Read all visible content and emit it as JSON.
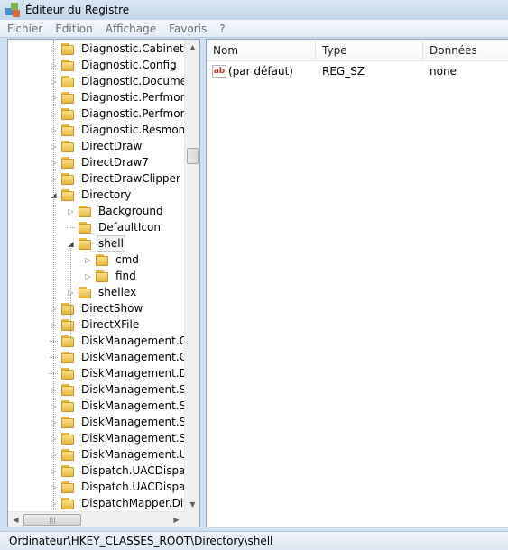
{
  "window": {
    "title": "Éditeur du Registre"
  },
  "menu": [
    "Fichier",
    "Edition",
    "Affichage",
    "Favoris",
    "?"
  ],
  "tree": {
    "items": [
      {
        "label": "Diagnostic.Cabinet",
        "expander": "collapsed"
      },
      {
        "label": "Diagnostic.Config",
        "expander": "collapsed"
      },
      {
        "label": "Diagnostic.Document",
        "expander": "collapsed"
      },
      {
        "label": "Diagnostic.Perfmon.C",
        "expander": "collapsed"
      },
      {
        "label": "Diagnostic.Perfmon.D",
        "expander": "collapsed"
      },
      {
        "label": "Diagnostic.Resmon.C",
        "expander": "collapsed"
      },
      {
        "label": "DirectDraw",
        "expander": "collapsed"
      },
      {
        "label": "DirectDraw7",
        "expander": "collapsed"
      },
      {
        "label": "DirectDrawClipper",
        "expander": "collapsed"
      },
      {
        "label": "Directory",
        "expander": "expanded"
      },
      {
        "label": "Background",
        "expander": "collapsed"
      },
      {
        "label": "DefaultIcon",
        "expander": "none"
      },
      {
        "label": "shell",
        "expander": "expanded",
        "selected": true
      },
      {
        "label": "cmd",
        "expander": "collapsed"
      },
      {
        "label": "find",
        "expander": "collapsed"
      },
      {
        "label": "shellex",
        "expander": "collapsed"
      },
      {
        "label": "DirectShow",
        "expander": "collapsed"
      },
      {
        "label": "DirectXFile",
        "expander": "collapsed"
      },
      {
        "label": "DiskManagement.Cor",
        "expander": "none"
      },
      {
        "label": "DiskManagement.Cor",
        "expander": "none"
      },
      {
        "label": "DiskManagement.Dat",
        "expander": "none"
      },
      {
        "label": "DiskManagement.Sna",
        "expander": "collapsed"
      },
      {
        "label": "DiskManagement.Sna",
        "expander": "collapsed"
      },
      {
        "label": "DiskManagement.Sna",
        "expander": "collapsed"
      },
      {
        "label": "DiskManagement.Sna",
        "expander": "collapsed"
      },
      {
        "label": "DiskManagement.UIT",
        "expander": "collapsed"
      },
      {
        "label": "Dispatch.UACDispatcl",
        "expander": "collapsed"
      },
      {
        "label": "Dispatch.UACDispatcl",
        "expander": "collapsed"
      },
      {
        "label": "DispatchMapper.Disp",
        "expander": "collapsed"
      }
    ]
  },
  "values_list": {
    "columns": [
      "Nom",
      "Type",
      "Données"
    ],
    "rows": [
      {
        "name": "(par défaut)",
        "type": "REG_SZ",
        "data": "none",
        "icon": "string-value-icon"
      }
    ]
  },
  "status": {
    "path": "Ordinateur\\HKEY_CLASSES_ROOT\\Directory\\shell"
  },
  "colors": {
    "title_bar": "#c2d5ea",
    "folder": "#e7b73d",
    "selection_border": "#c9c9c9"
  }
}
